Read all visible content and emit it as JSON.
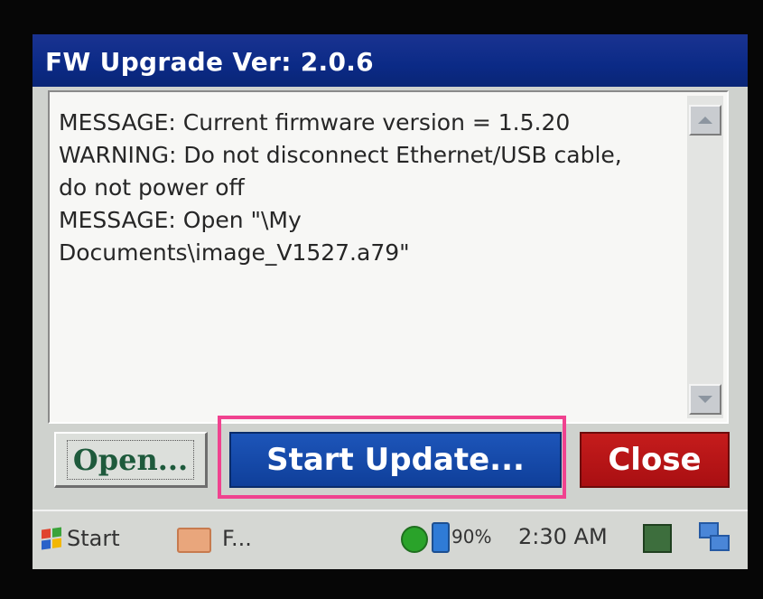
{
  "window": {
    "title": "FW Upgrade Ver: 2.0.6"
  },
  "log": {
    "text": "MESSAGE: Current firmware version = 1.5.20\nWARNING: Do not disconnect Ethernet/USB cable,\ndo not power off\nMESSAGE: Open \"\\My\nDocuments\\image_V1527.a79\""
  },
  "buttons": {
    "open_label": "Open...",
    "start_update_label": "Start Update...",
    "close_label": "Close"
  },
  "taskbar": {
    "start_label": "Start",
    "task_label": "F...",
    "battery": "90%",
    "clock": "2:30 AM"
  },
  "colors": {
    "title_bar": "#0b2a86",
    "start_update_button": "#1d55b9",
    "close_button": "#c51c1c",
    "highlight": "#f0428f"
  },
  "icons": [
    "scroll-up-icon",
    "scroll-down-icon",
    "windows-flag-icon",
    "folder-icon",
    "signal-icon",
    "battery-icon",
    "input-method-icon",
    "network-icon"
  ]
}
